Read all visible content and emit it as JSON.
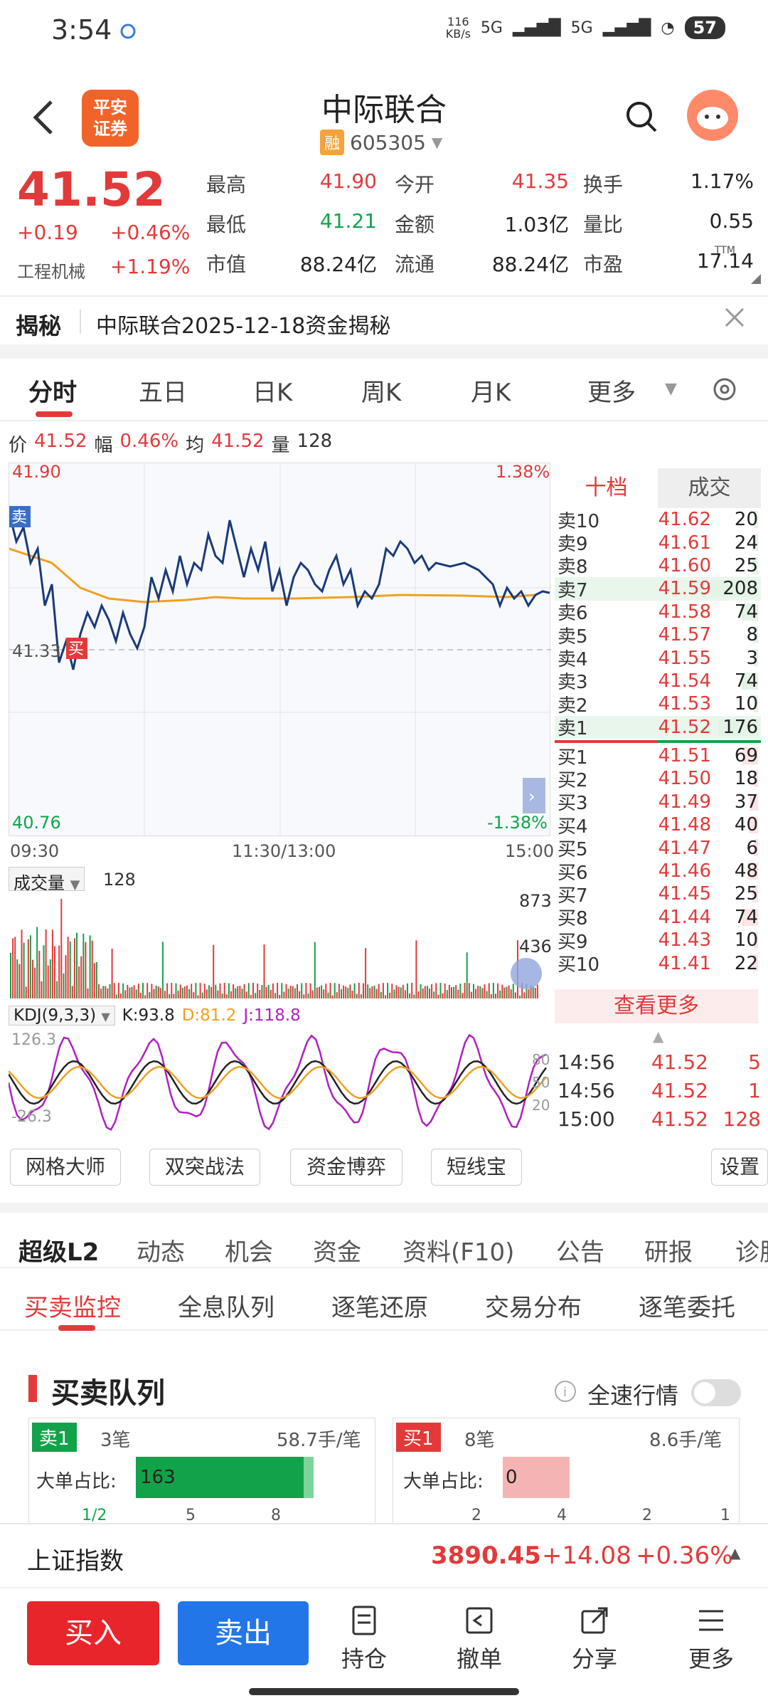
{
  "status_bar": {
    "time": "3:54",
    "net_speed": "116\nKB/s",
    "signal1": "5G",
    "signal2": "5G",
    "battery": "57"
  },
  "header": {
    "logo": "平安\n证券",
    "title": "中际联合",
    "badge": "融",
    "code": "605305"
  },
  "quote": {
    "price": "41.52",
    "change": "+0.19",
    "change_pct": "+0.46%",
    "industry": "工程机械",
    "industry_pct": "+1.19%",
    "fields": [
      {
        "label": "最高",
        "value": "41.90",
        "color": "#e23a3a"
      },
      {
        "label": "今开",
        "value": "41.35",
        "color": "#e23a3a"
      },
      {
        "label": "换手",
        "value": "1.17%",
        "color": "#222"
      },
      {
        "label": "最低",
        "value": "41.21",
        "color": "#12a34a"
      },
      {
        "label": "金额",
        "value": "1.03亿",
        "color": "#222"
      },
      {
        "label": "量比",
        "value": "0.55",
        "color": "#222"
      },
      {
        "label": "市值",
        "value": "88.24亿",
        "color": "#222"
      },
      {
        "label": "流通",
        "value": "88.24亿",
        "color": "#222"
      },
      {
        "label": "市盈",
        "value": "17.14",
        "color": "#222"
      }
    ],
    "ttm": "TTM"
  },
  "reveal": {
    "label": "揭秘",
    "text": "中际联合2025-12-18资金揭秘"
  },
  "chart_tabs": [
    "分时",
    "五日",
    "日K",
    "周K",
    "月K",
    "更多"
  ],
  "info_line": {
    "price_label": "价",
    "price": "41.52",
    "amp_label": "幅",
    "amp": "0.46%",
    "avg_label": "均",
    "avg": "41.52",
    "vol_label": "量",
    "vol": "128"
  },
  "chart_data": {
    "type": "line",
    "x_labels": [
      "09:30",
      "11:30/13:00",
      "15:00"
    ],
    "ylim": [
      40.76,
      41.9
    ],
    "y_labels_left": [
      "41.90",
      "41.33",
      "40.76"
    ],
    "y_labels_right": [
      "1.38%",
      "-1.38%"
    ],
    "series": [],
    "markers": [
      "卖",
      "买"
    ],
    "volume_label": "成交量",
    "volume_value": "128",
    "volume_ticks": [
      "873",
      "436"
    ],
    "kdj_label": "KDJ(9,3,3)",
    "kdj_k": "K:93.8",
    "kdj_d": "D:81.2",
    "kdj_j": "J:118.8",
    "kdj_ticks": [
      "126.3",
      "-26.3",
      "80",
      "50",
      "20"
    ]
  },
  "orderbook": {
    "tabs": [
      "十档",
      "成交"
    ],
    "asks": [
      {
        "name": "卖10",
        "price": "41.62",
        "vol": "20"
      },
      {
        "name": "卖9",
        "price": "41.61",
        "vol": "24"
      },
      {
        "name": "卖8",
        "price": "41.60",
        "vol": "25"
      },
      {
        "name": "卖7",
        "price": "41.59",
        "vol": "208"
      },
      {
        "name": "卖6",
        "price": "41.58",
        "vol": "74"
      },
      {
        "name": "卖5",
        "price": "41.57",
        "vol": "8"
      },
      {
        "name": "卖4",
        "price": "41.55",
        "vol": "3"
      },
      {
        "name": "卖3",
        "price": "41.54",
        "vol": "74"
      },
      {
        "name": "卖2",
        "price": "41.53",
        "vol": "10"
      },
      {
        "name": "卖1",
        "price": "41.52",
        "vol": "176"
      }
    ],
    "bids": [
      {
        "name": "买1",
        "price": "41.51",
        "vol": "69"
      },
      {
        "name": "买2",
        "price": "41.50",
        "vol": "18"
      },
      {
        "name": "买3",
        "price": "41.49",
        "vol": "37"
      },
      {
        "name": "买4",
        "price": "41.48",
        "vol": "40"
      },
      {
        "name": "买5",
        "price": "41.47",
        "vol": "6"
      },
      {
        "name": "买6",
        "price": "41.46",
        "vol": "48"
      },
      {
        "name": "买7",
        "price": "41.45",
        "vol": "25"
      },
      {
        "name": "买8",
        "price": "41.44",
        "vol": "74"
      },
      {
        "name": "买9",
        "price": "41.43",
        "vol": "10"
      },
      {
        "name": "买10",
        "price": "41.41",
        "vol": "22"
      }
    ],
    "see_more": "查看更多",
    "ticks": [
      {
        "time": "14:56",
        "price": "41.52",
        "vol": "5"
      },
      {
        "time": "14:56",
        "price": "41.52",
        "vol": "1"
      },
      {
        "time": "15:00",
        "price": "41.52",
        "vol": "128"
      }
    ]
  },
  "tools": [
    "网格大师",
    "双突战法",
    "资金博弈",
    "短线宝",
    "设置"
  ],
  "section_tabs": [
    "超级L2",
    "动态",
    "机会",
    "资金",
    "资料(F10)",
    "公告",
    "研报",
    "诊股"
  ],
  "sub_tabs": [
    "买卖监控",
    "全息队列",
    "逐笔还原",
    "交易分布",
    "逐笔委托"
  ],
  "queue": {
    "title": "买卖队列",
    "fast_label": "全速行情",
    "sell": {
      "tag": "卖1",
      "count": "3笔",
      "avg": "58.7手/笔",
      "ratio_label": "大单占比:",
      "ratio": "163",
      "axis": [
        "1/2",
        "5",
        "8"
      ]
    },
    "buy": {
      "tag": "买1",
      "count": "8笔",
      "avg": "8.6手/笔",
      "ratio_label": "大单占比:",
      "ratio": "0",
      "axis": [
        "2",
        "4",
        "2",
        "1"
      ]
    }
  },
  "index_bar": {
    "name": "上证指数",
    "value": "3890.45",
    "change": "+14.08",
    "pct": "+0.36%"
  },
  "bottom_nav": {
    "buy": "买入",
    "sell": "卖出",
    "items": [
      "持仓",
      "撤单",
      "分享",
      "更多"
    ]
  },
  "colors": {
    "up": "#e23a3a",
    "down": "#12a34a",
    "buy_btn": "#e8252b",
    "sell_btn": "#2276e8",
    "price_line": "#1a3a7a",
    "avg_line": "#f0a020"
  }
}
